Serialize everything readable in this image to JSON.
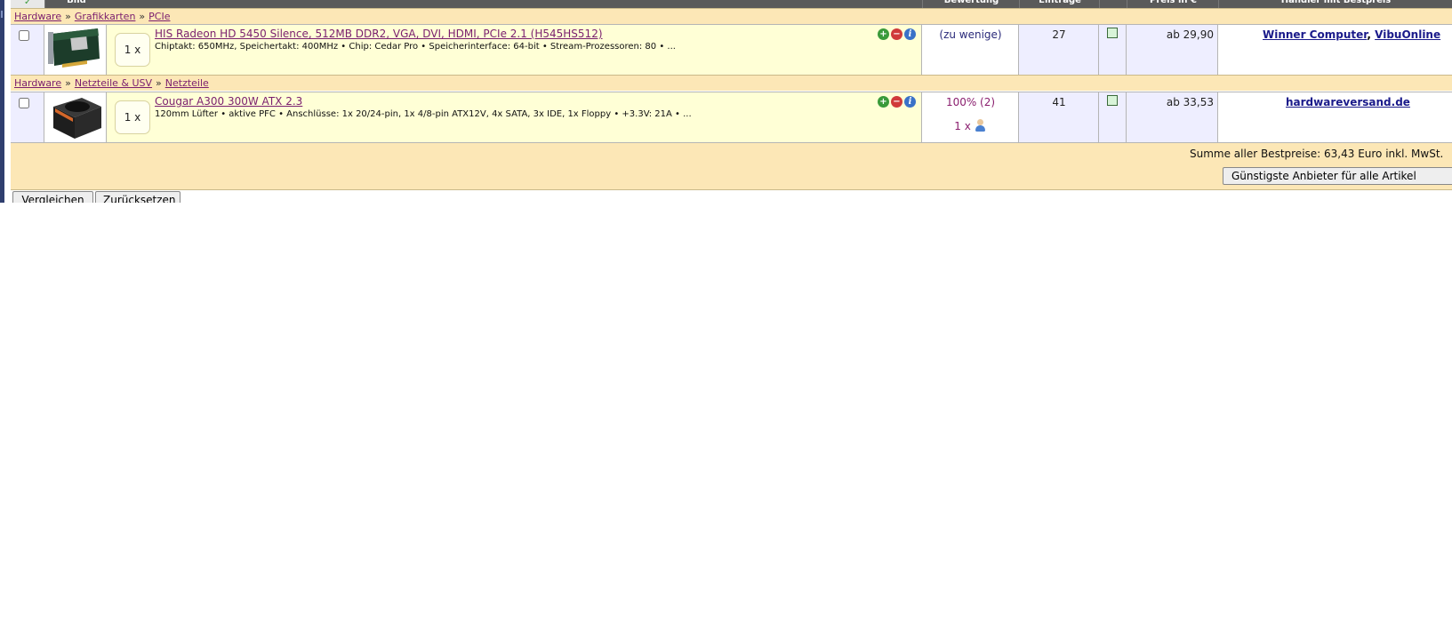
{
  "header": {
    "columns": [
      "Bild",
      "Bewertung",
      "Einträge",
      "Preis in €",
      "Händler mit Bestpreis"
    ]
  },
  "groups": [
    {
      "breadcrumb": [
        "Hardware",
        "Grafikkarten",
        "PCIe"
      ],
      "item": {
        "quantity": "1 x",
        "title": "HIS Radeon HD 5450 Silence, 512MB DDR2, VGA, DVI, HDMI, PCIe 2.1 (H545HS512)",
        "description": "Chiptakt: 650MHz, Speichertakt: 400MHz • Chip: Cedar Pro • Speicherinterface: 64-bit • Stream-Prozessoren: 80 • ...",
        "rating": "(zu wenige)",
        "rating_count": "",
        "entries": "27",
        "price": "ab 29,90",
        "vendors": [
          "Winner Computer",
          "VibuOnline"
        ]
      }
    },
    {
      "breadcrumb": [
        "Hardware",
        "Netzteile & USV",
        "Netzteile"
      ],
      "item": {
        "quantity": "1 x",
        "title": "Cougar A300 300W ATX 2.3",
        "description": "120mm Lüfter • aktive PFC • Anschlüsse: 1x 20/24-pin, 1x 4/8-pin ATX12V, 4x SATA, 3x IDE, 1x Floppy • +3.3V: 21A • ...",
        "rating": "100% (2)",
        "rating_count": "1 x",
        "entries": "41",
        "price": "ab 33,53",
        "vendors": [
          "hardwareversand.de"
        ]
      }
    }
  ],
  "summary": {
    "text": "Summe aller Bestpreise: 63,43 Euro inkl. MwSt.",
    "cheapest_button": "Günstigste Anbieter für alle Artikel"
  },
  "buttons": {
    "compare": "Vergleichen",
    "reset": "Zurücksetzen"
  },
  "icons": {
    "add": "plus-circle-icon",
    "remove": "minus-circle-icon",
    "info": "info-circle-icon",
    "user": "user-icon"
  },
  "colors": {
    "link": "#7a1e6e",
    "vendor_link": "#1a1a8a",
    "breadcrumb_bg": "#fce7b6",
    "item_bg": "#ffffd6",
    "header_bg": "#5a5a5a"
  }
}
